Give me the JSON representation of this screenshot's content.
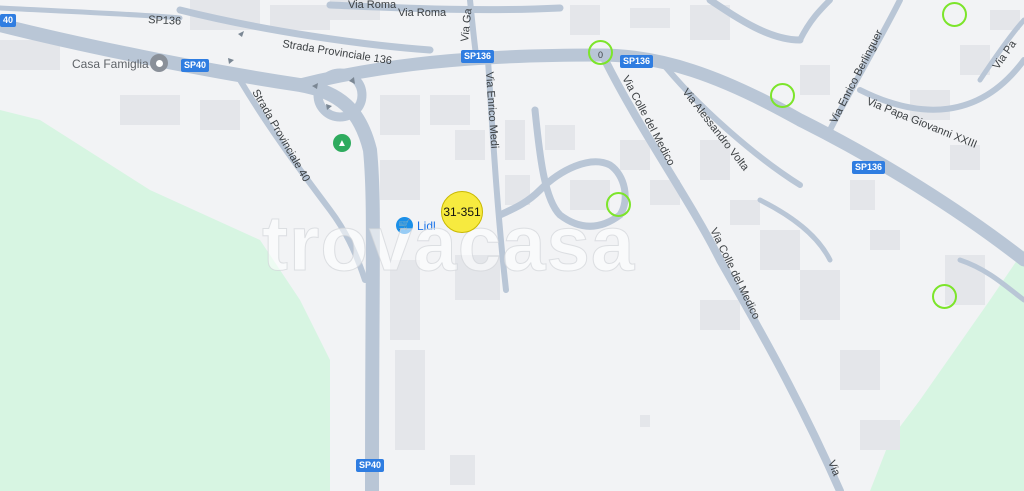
{
  "map": {
    "watermark": "trovacasa",
    "roads": {
      "via_roma_top": "Via Roma",
      "via_roma": "Via Roma",
      "sp136_top": "SP136",
      "strada_provinciale_136": "Strada Provinciale 136",
      "strada_provinciale_40": "Strada Provinciale 40",
      "via_enrico_medi": "Via Enrico Medi",
      "via_ga": "Via Ga",
      "via_colle_del_medico_1": "Via Colle del Medico",
      "via_colle_del_medico_2": "Via Colle del Medico",
      "via_alessandro_volta": "Via Alessandro Volta",
      "via_enrico_berlinguer": "Via Enrico Berlinguer",
      "via_papa_giovanni": "Via Papa Giovanni XXIII",
      "via_pa": "Via Pa",
      "via_bottom": "Via"
    },
    "shields": {
      "sp136_a": "SP136",
      "sp136_b": "SP136",
      "sp136_c": "SP136",
      "sp40_a": "SP40",
      "sp40_b": "SP40",
      "sp40_left": "40",
      "route_left": "0"
    },
    "pois": {
      "casa_famiglia": "Casa Famiglia",
      "lidl": "Lidl"
    },
    "cluster": {
      "label": "31-351",
      "color": "#f7ea3f"
    },
    "marker_color": "#7ce52a",
    "park_color": "#d7f5e2",
    "road_color": "#b9c6d6"
  }
}
